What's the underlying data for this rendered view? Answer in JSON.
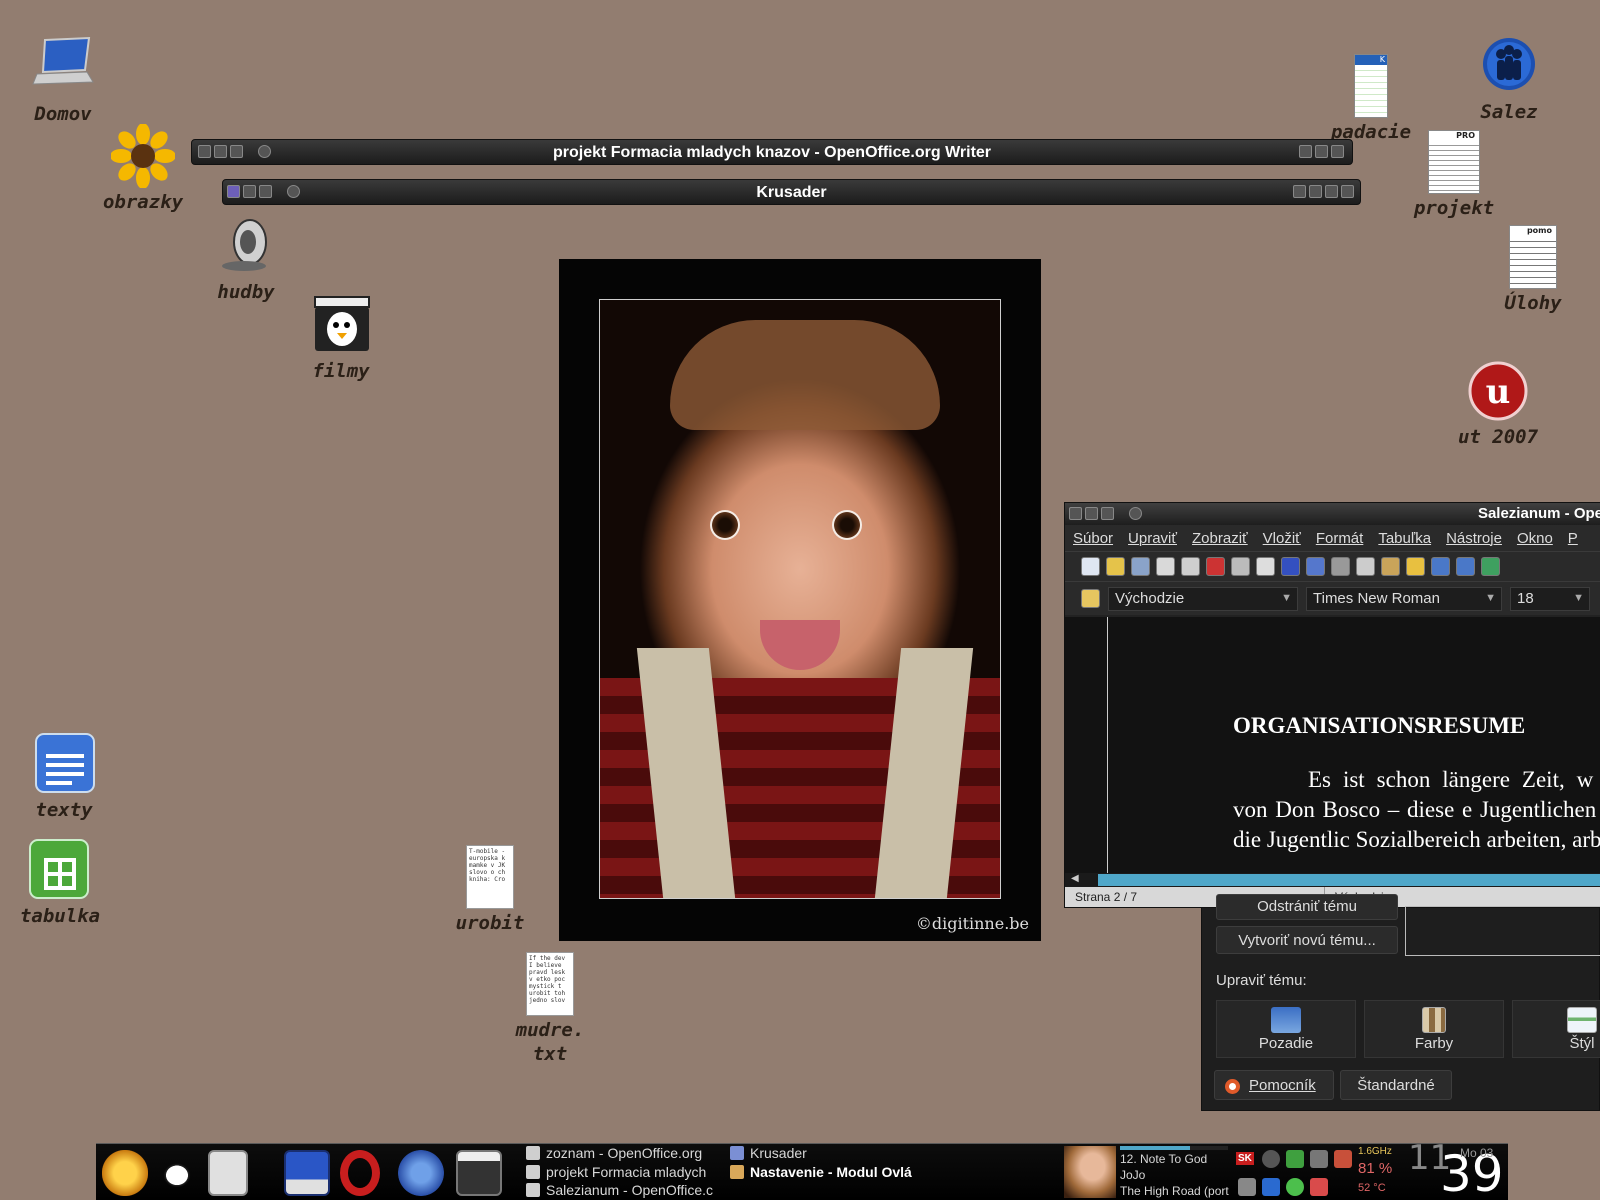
{
  "desktop_icons": {
    "domov": "Domov",
    "obrazky": "obrazky",
    "hudby": "hudby",
    "filmy": "filmy",
    "texty": "texty",
    "tabulka": "tabulka",
    "urobit": "urobit",
    "mudre": "mudre.\ntxt",
    "padacie": "padacie",
    "salez": "Salez",
    "projekt": "projekt",
    "ulohy": "Úlohy",
    "ut2007": "ut 2007"
  },
  "urobit_preview": "T-mobile - europska k mamke v JK slovo o ch kniha: Cro",
  "mudre_preview": "If the dev I believe pravd lesk v etko poc mystick t urobit toh jedno slov",
  "projekt_thumb_head": "PRO",
  "ulohy_thumb_head": "pomo",
  "padacie_thumb_head": "K",
  "windows": {
    "writer_title": "projekt Formacia mladych knazov - OpenOffice.org Writer",
    "krusader_title": "Krusader"
  },
  "photo": {
    "watermark": "©digitinne.be"
  },
  "salezianum": {
    "title": "Salezianum - Ope",
    "menu": [
      "Súbor",
      "Upraviť",
      "Zobraziť",
      "Vložiť",
      "Formát",
      "Tabuľka",
      "Nástroje",
      "Okno",
      "P"
    ],
    "style": "Východzie",
    "font": "Times New Roman",
    "size": "18",
    "heading": "ORGANISATIONSRESUME",
    "body": "Es ist schon längere Zeit, w System von Don Bosco – diese e Jugentlichen und für die Jugentlic Sozialbereich arbeiten, arbieten la",
    "status_page": "Strana 2 / 7",
    "status_style": "Východzie"
  },
  "theme_panel": {
    "remove_theme": "Odstrániť tému",
    "new_theme": "Vytvoriť novú tému...",
    "edit_label": "Upraviť tému:",
    "tiles": [
      "Pozadie",
      "Farby",
      "Štýl"
    ],
    "help": "Pomocník",
    "defaults": "Štandardné"
  },
  "taskbar": {
    "tasks_col1": [
      "zoznam - OpenOffice.org",
      "projekt Formacia mladych",
      "Salezianum - OpenOffice.c"
    ],
    "tasks_col2": [
      "Krusader",
      "Nastavenie - Modul Ovlá"
    ],
    "media_track": "12. Note To God",
    "media_artist": "JoJo",
    "media_album": "The High Road (port",
    "media_progress": 0.65,
    "lang": "SK",
    "cpu_freq": "1.6GHz",
    "cpu_percent": "81 %",
    "temp": "52 °C",
    "clock_hour": "11",
    "clock_min": "39",
    "clock_day": "Mo 03"
  },
  "colors": {
    "desktop": "#927d70",
    "accent_blue": "#4fa7c9"
  }
}
